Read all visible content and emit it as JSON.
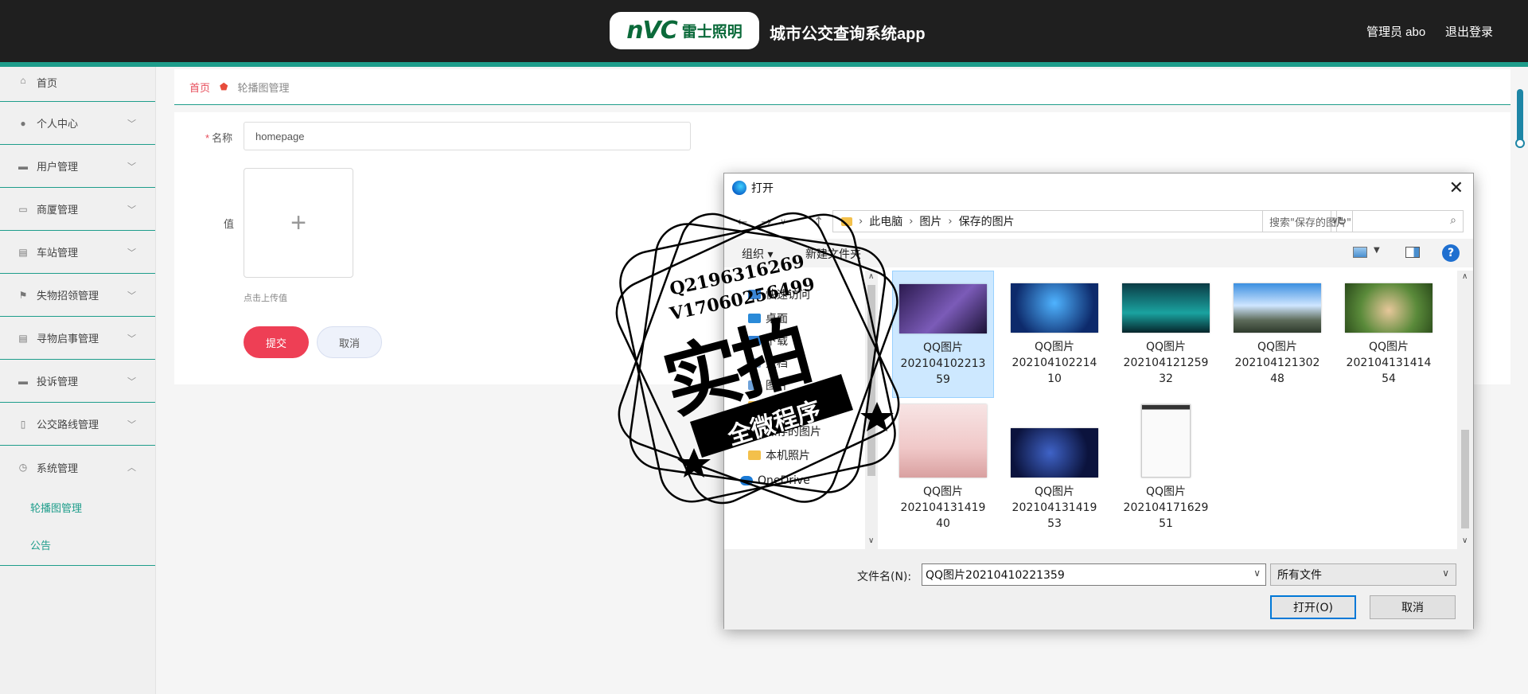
{
  "header": {
    "logo_brand": "nVC",
    "logo_cn": "雷士照明",
    "app_title": "城市公交查询系统app",
    "user_label": "管理员 abo",
    "logout_label": "退出登录"
  },
  "sidebar": {
    "items": [
      {
        "label": "首页",
        "icon": "home-icon",
        "glyph": "⌂"
      },
      {
        "label": "个人中心",
        "icon": "user-icon",
        "glyph": "●"
      },
      {
        "label": "用户管理",
        "icon": "users-icon",
        "glyph": "▬"
      },
      {
        "label": "商厦管理",
        "icon": "building-icon",
        "glyph": "▭"
      },
      {
        "label": "车站管理",
        "icon": "station-icon",
        "glyph": "▤"
      },
      {
        "label": "失物招领管理",
        "icon": "flag-icon",
        "glyph": "⚑"
      },
      {
        "label": "寻物启事管理",
        "icon": "clipboard-icon",
        "glyph": "▤"
      },
      {
        "label": "投诉管理",
        "icon": "monitor-icon",
        "glyph": "▬"
      },
      {
        "label": "公交路线管理",
        "icon": "phone-icon",
        "glyph": "▯"
      },
      {
        "label": "系统管理",
        "icon": "clock-icon",
        "glyph": "◷"
      }
    ],
    "sub_items": [
      {
        "label": "轮播图管理"
      },
      {
        "label": "公告"
      }
    ]
  },
  "breadcrumb": {
    "home": "首页",
    "current": "轮播图管理"
  },
  "form": {
    "name_label": "名称",
    "name_value": "homepage",
    "value_label": "值",
    "upload_hint": "点击上传值",
    "submit_label": "提交",
    "cancel_label": "取消"
  },
  "dialog": {
    "title": "打开",
    "path": [
      "此电脑",
      "图片",
      "保存的图片"
    ],
    "search_placeholder": "搜索\"保存的图片\"",
    "toolbar_organize": "组织 ▾",
    "toolbar_new_folder": "新建文件夹",
    "tree": [
      {
        "label": "快速访问"
      },
      {
        "label": "桌面"
      },
      {
        "label": "下载"
      },
      {
        "label": "文档"
      },
      {
        "label": "图片"
      },
      {
        "label": "202"
      },
      {
        "label": "保存的图片"
      },
      {
        "label": "本机照片"
      },
      {
        "label": "OneDrive"
      }
    ],
    "files": [
      {
        "line1": "QQ图片",
        "line2": "202104102213",
        "line3": "59",
        "selected": true
      },
      {
        "line1": "QQ图片",
        "line2": "202104102214",
        "line3": "10"
      },
      {
        "line1": "QQ图片",
        "line2": "202104121259",
        "line3": "32"
      },
      {
        "line1": "QQ图片",
        "line2": "202104121302",
        "line3": "48"
      },
      {
        "line1": "QQ图片",
        "line2": "202104131414",
        "line3": "54"
      },
      {
        "line1": "QQ图片",
        "line2": "202104131419",
        "line3": "40"
      },
      {
        "line1": "QQ图片",
        "line2": "202104131419",
        "line3": "53"
      },
      {
        "line1": "QQ图片",
        "line2": "202104171629",
        "line3": "51"
      }
    ],
    "filename_label": "文件名(N):",
    "filename_value": "QQ图片20210410221359",
    "filetype_value": "所有文件",
    "open_label": "打开(O)",
    "cancel_label": "取消"
  },
  "watermark": {
    "line1": "Q2196316269",
    "line2": "V17060256499",
    "big": "实拍",
    "banner": "全微程序"
  },
  "colors": {
    "accent": "#1e9d8b",
    "header_bg": "#1f1f1f",
    "submit": "#ee3f55",
    "crumb_home": "#e74c5a"
  }
}
